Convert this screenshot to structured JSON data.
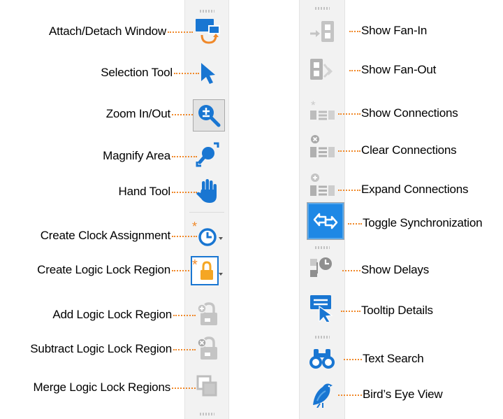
{
  "colors": {
    "primary_icon": "#1976d2",
    "accent_orange": "#f0892a",
    "disabled_icon": "#b9b9b9",
    "toolbar_bg": "#f2f2f2"
  },
  "left_toolbar": {
    "items": [
      {
        "label": "Attach/Detach Window",
        "icon": "attach-detach-window-icon",
        "enabled": true
      },
      {
        "label": "Selection Tool",
        "icon": "selection-tool-icon",
        "enabled": true
      },
      {
        "label": "Zoom In/Out",
        "icon": "zoom-in-out-icon",
        "enabled": true,
        "selected": true
      },
      {
        "label": "Magnify Area",
        "icon": "magnify-area-icon",
        "enabled": true
      },
      {
        "label": "Hand Tool",
        "icon": "hand-tool-icon",
        "enabled": true
      },
      {
        "label": "Create Clock Assignment",
        "icon": "create-clock-assignment-icon",
        "enabled": true,
        "has_dropdown": true
      },
      {
        "label": "Create Logic Lock Region",
        "icon": "create-logic-lock-region-icon",
        "enabled": true,
        "has_dropdown": true
      },
      {
        "label": "Add Logic Lock Region",
        "icon": "add-logic-lock-region-icon",
        "enabled": false
      },
      {
        "label": "Subtract Logic Lock Region",
        "icon": "subtract-logic-lock-region-icon",
        "enabled": false
      },
      {
        "label": "Merge Logic Lock Regions",
        "icon": "merge-logic-lock-regions-icon",
        "enabled": false
      }
    ]
  },
  "right_toolbar": {
    "items": [
      {
        "label": "Show Fan-In",
        "icon": "show-fan-in-icon",
        "enabled": false
      },
      {
        "label": "Show Fan-Out",
        "icon": "show-fan-out-icon",
        "enabled": false
      },
      {
        "label": "Show Connections",
        "icon": "show-connections-icon",
        "enabled": false
      },
      {
        "label": "Clear Connections",
        "icon": "clear-connections-icon",
        "enabled": false
      },
      {
        "label": "Expand Connections",
        "icon": "expand-connections-icon",
        "enabled": false
      },
      {
        "label": "Toggle Synchronization",
        "icon": "toggle-synchronization-icon",
        "enabled": true,
        "selected": true
      },
      {
        "label": "Show Delays",
        "icon": "show-delays-icon",
        "enabled": false
      },
      {
        "label": "Tooltip Details",
        "icon": "tooltip-details-icon",
        "enabled": true
      },
      {
        "label": "Text Search",
        "icon": "text-search-icon",
        "enabled": true
      },
      {
        "label": "Bird’s Eye View",
        "icon": "birds-eye-view-icon",
        "enabled": true
      }
    ]
  }
}
